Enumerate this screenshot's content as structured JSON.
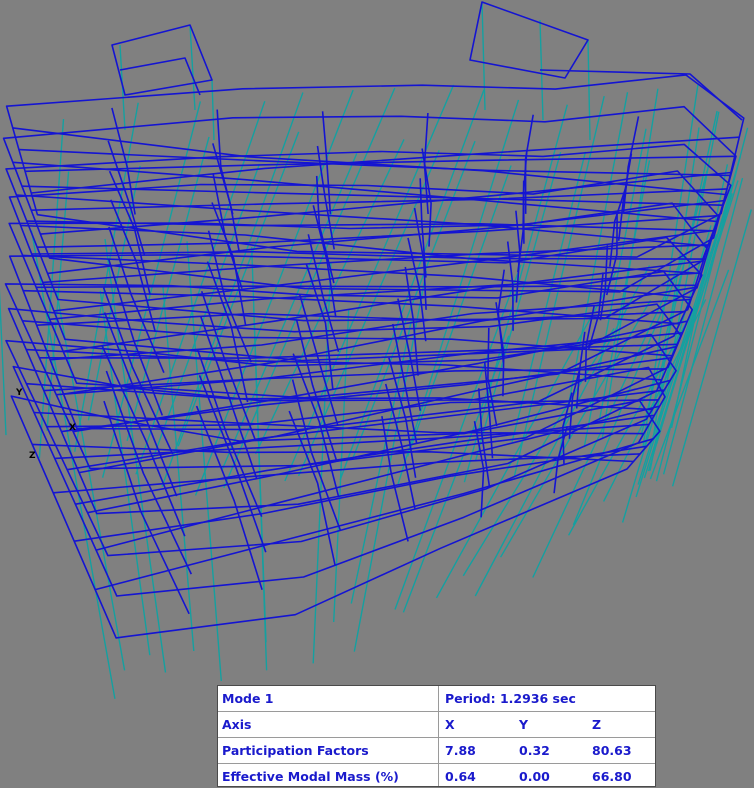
{
  "viewport": {
    "background": "#808080",
    "frame_color": "#1414d2",
    "column_color": "#14a0a0",
    "axis_labels": [
      "Y",
      "X",
      "Z"
    ]
  },
  "mode_table": {
    "mode": "Mode 1",
    "period": "Period: 1.2936 sec",
    "axis_label": "Axis",
    "axis_x": "X",
    "axis_y": "Y",
    "axis_z": "Z",
    "participation_label": "Participation Factors",
    "participation_x": "7.88",
    "participation_y": "0.32",
    "participation_z": "80.63",
    "mass_label": "Effective Modal Mass (%)",
    "mass_x": "0.64",
    "mass_y": "0.00",
    "mass_z": "66.80"
  }
}
